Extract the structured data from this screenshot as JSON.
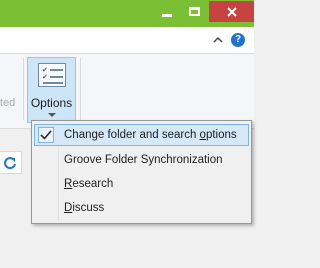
{
  "window": {
    "minimize_icon": "minimize-icon",
    "maximize_icon": "maximize-icon",
    "close_icon": "close-icon",
    "accent": "#7bbf34",
    "close_color": "#c7433f"
  },
  "tabstrip": {
    "collapse_icon": "chevron-up-icon",
    "help_label": "?"
  },
  "ribbon": {
    "left_partial_label": "ted",
    "options": {
      "label": "Options",
      "icon": "folder-options-icon"
    }
  },
  "menu": {
    "items": [
      {
        "prefix": "Change folder and search ",
        "accel": "o",
        "suffix": "ptions",
        "checked": true
      },
      {
        "prefix": "Groove Folder Synchronization",
        "accel": "",
        "suffix": ""
      },
      {
        "prefix": "",
        "accel": "R",
        "suffix": "esearch"
      },
      {
        "prefix": "",
        "accel": "D",
        "suffix": "iscuss"
      }
    ]
  },
  "address": {
    "refresh_icon": "refresh-icon"
  }
}
